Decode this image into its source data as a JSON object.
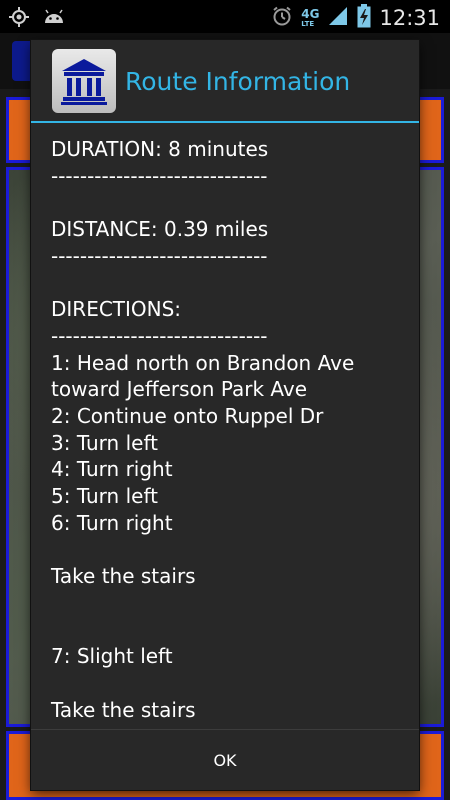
{
  "status_bar": {
    "time": "12:31",
    "network": "4G",
    "network_sub": "LTE",
    "icons": [
      "gps-icon",
      "android-icon",
      "alarm-icon",
      "signal-icon",
      "battery-charging-icon"
    ]
  },
  "dialog": {
    "title": "Route Information",
    "icon": "university-building-icon",
    "lines": [
      "DURATION: 8 minutes",
      "------------------------------",
      "",
      "DISTANCE: 0.39 miles",
      "------------------------------",
      "",
      "DIRECTIONS:",
      "------------------------------",
      "1: Head north on Brandon Ave toward Jefferson Park Ave",
      "2: Continue onto Ruppel Dr",
      "3: Turn left",
      "4: Turn right",
      "5: Turn left",
      "6: Turn right",
      "",
      "Take the stairs",
      "",
      "",
      "7: Slight left",
      "",
      "Take the stairs"
    ],
    "ok_label": "OK"
  },
  "colors": {
    "accent": "#33b5e5",
    "dialog_bg": "#282828",
    "app_orange": "#e0651a",
    "app_blue": "#1b1bd8"
  }
}
